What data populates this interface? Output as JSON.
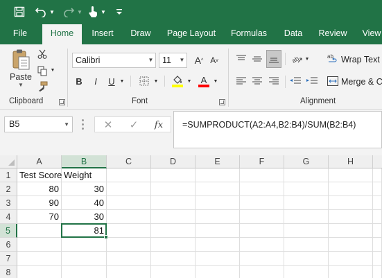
{
  "qat": {
    "icons": [
      "save-icon",
      "undo-icon",
      "redo-icon",
      "touch-mode-icon",
      "customize-qat-icon"
    ]
  },
  "tabs": [
    "File",
    "Home",
    "Insert",
    "Draw",
    "Page Layout",
    "Formulas",
    "Data",
    "Review",
    "View"
  ],
  "active_tab": "Home",
  "ribbon": {
    "clipboard": {
      "paste_label": "Paste",
      "group_label": "Clipboard"
    },
    "font": {
      "font_name": "Calibri",
      "font_size": "11",
      "bold": "B",
      "italic": "I",
      "underline": "U",
      "group_label": "Font",
      "fill_color": "#FFFF00",
      "font_color": "#FF0000"
    },
    "alignment": {
      "wrap_text_label": "Wrap Text",
      "merge_label": "Merge & C",
      "group_label": "Alignment"
    }
  },
  "formula_bar": {
    "name_box": "B5",
    "fx_label": "fx",
    "formula": "=SUMPRODUCT(A2:A4,B2:B4)/SUM(B2:B4)"
  },
  "sheet": {
    "columns": [
      "A",
      "B",
      "C",
      "D",
      "E",
      "F",
      "G",
      "H"
    ],
    "rows": [
      "1",
      "2",
      "3",
      "4",
      "5",
      "6",
      "7",
      "8"
    ],
    "cells": {
      "A1": "Test Score",
      "B1": "Weight",
      "A2": "80",
      "B2": "30",
      "A3": "90",
      "B3": "40",
      "A4": "70",
      "B4": "30",
      "B5": "81"
    },
    "selected_cell": "B5"
  },
  "colors": {
    "accent": "#217346"
  }
}
